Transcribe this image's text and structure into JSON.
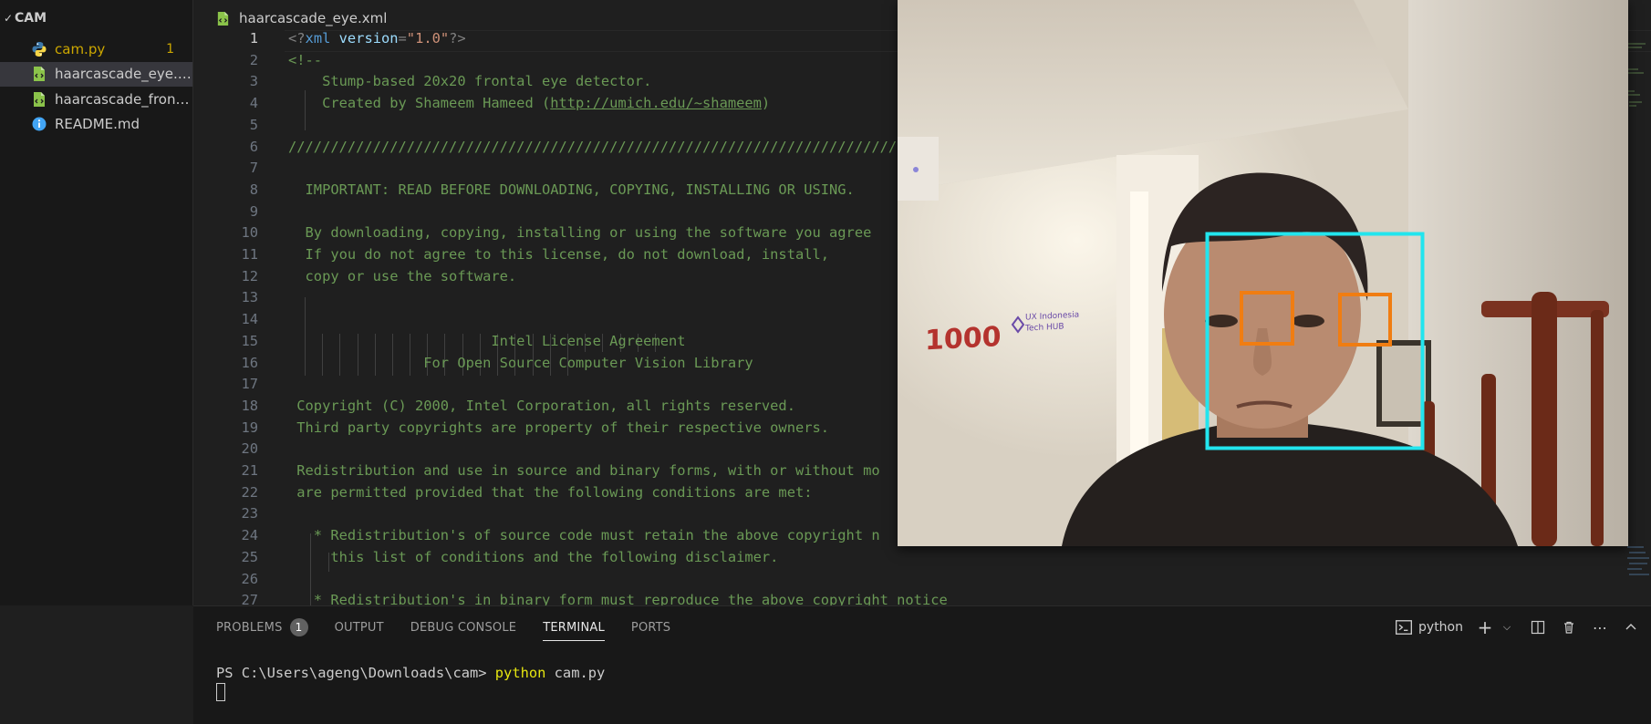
{
  "explorer": {
    "folder": "CAM",
    "files": [
      {
        "name": "cam.py",
        "type": "python",
        "count": "1"
      },
      {
        "name": "haarcascade_eye.xml",
        "type": "xml",
        "selected": true
      },
      {
        "name": "haarcascade_fronta...",
        "type": "xml"
      },
      {
        "name": "README.md",
        "type": "info"
      }
    ]
  },
  "editor": {
    "breadcrumb": "haarcascade_eye.xml",
    "xml_decl": {
      "open": "<?",
      "tag": "xml",
      "attr": "version",
      "eq": "=",
      "value": "\"1.0\"",
      "close": "?>"
    },
    "lines": [
      {
        "n": "1",
        "text": ""
      },
      {
        "n": "2",
        "text": "<!--"
      },
      {
        "n": "3",
        "text": "    Stump-based 20x20 frontal eye detector."
      },
      {
        "n": "4",
        "text": "    Created by Shameem Hameed (",
        "link": "http://umich.edu/~shameem",
        "after": ")"
      },
      {
        "n": "5",
        "text": ""
      },
      {
        "n": "6",
        "text": "//////////////////////////////////////////////////////////////////////////////////////"
      },
      {
        "n": "7",
        "text": ""
      },
      {
        "n": "8",
        "text": "  IMPORTANT: READ BEFORE DOWNLOADING, COPYING, INSTALLING OR USING."
      },
      {
        "n": "9",
        "text": ""
      },
      {
        "n": "10",
        "text": "  By downloading, copying, installing or using the software you agree"
      },
      {
        "n": "11",
        "text": "  If you do not agree to this license, do not download, install,"
      },
      {
        "n": "12",
        "text": "  copy or use the software."
      },
      {
        "n": "13",
        "text": ""
      },
      {
        "n": "14",
        "text": ""
      },
      {
        "n": "15",
        "text": "                        Intel License Agreement"
      },
      {
        "n": "16",
        "text": "                For Open Source Computer Vision Library"
      },
      {
        "n": "17",
        "text": ""
      },
      {
        "n": "18",
        "text": " Copyright (C) 2000, Intel Corporation, all rights reserved."
      },
      {
        "n": "19",
        "text": " Third party copyrights are property of their respective owners."
      },
      {
        "n": "20",
        "text": ""
      },
      {
        "n": "21",
        "text": " Redistribution and use in source and binary forms, with or without mo"
      },
      {
        "n": "22",
        "text": " are permitted provided that the following conditions are met:"
      },
      {
        "n": "23",
        "text": ""
      },
      {
        "n": "24",
        "text": "   * Redistribution's of source code must retain the above copyright n"
      },
      {
        "n": "25",
        "text": "     this list of conditions and the following disclaimer."
      },
      {
        "n": "26",
        "text": ""
      },
      {
        "n": "27",
        "text": "   * Redistribution's in binary form must reproduce the above copyright notice"
      }
    ]
  },
  "camera": {
    "wall_logo": "1000",
    "wall_sign_line1": "UX Indonesia",
    "wall_sign_line2": "Tech HUB"
  },
  "panel": {
    "tabs": [
      {
        "label": "PROBLEMS",
        "badge": "1"
      },
      {
        "label": "OUTPUT"
      },
      {
        "label": "DEBUG CONSOLE"
      },
      {
        "label": "TERMINAL",
        "active": true
      },
      {
        "label": "PORTS"
      }
    ],
    "terminal_name": "python",
    "prompt": "PS C:\\Users\\ageng\\Downloads\\cam> ",
    "command": "python",
    "args": " cam.py"
  },
  "colors": {
    "face_box": "#22e5ee",
    "eye_box": "#f07d12",
    "comment": "#6a9955"
  }
}
